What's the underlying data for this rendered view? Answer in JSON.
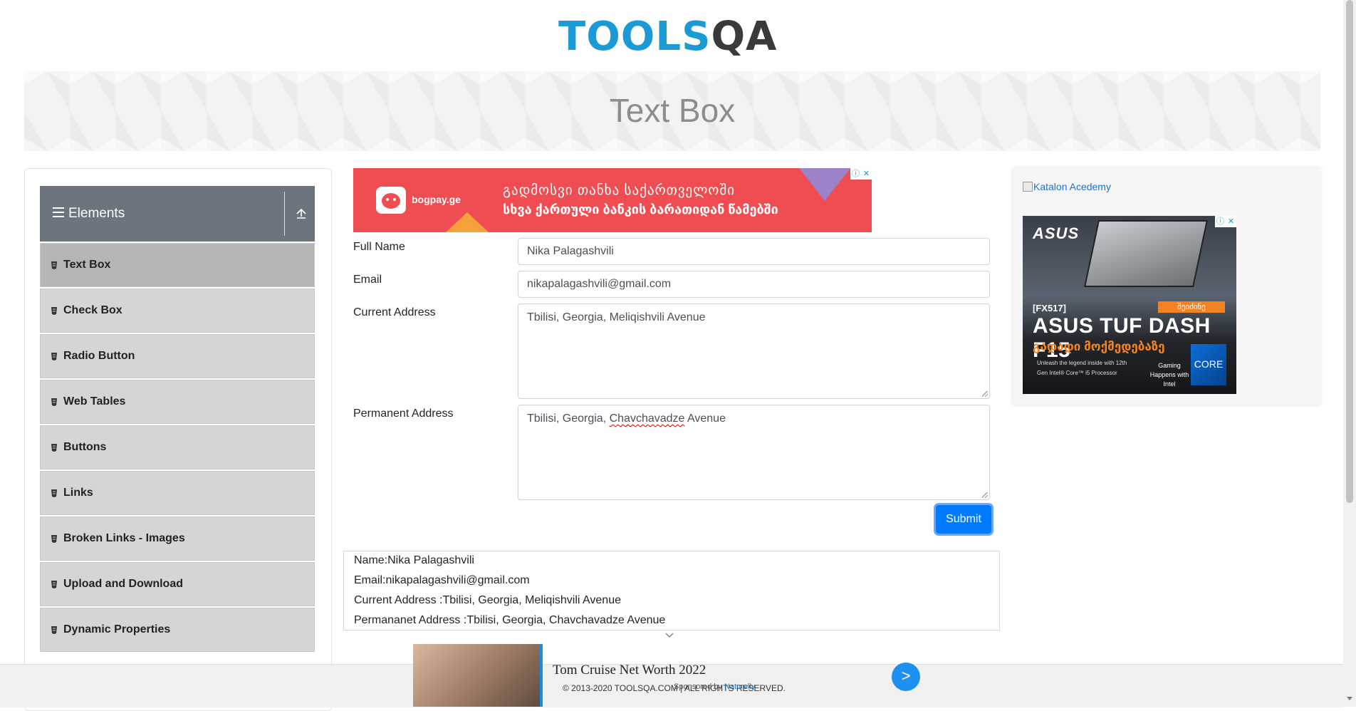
{
  "header": {
    "logo_text_blue": "TOOLS",
    "logo_text_dark": "QA",
    "logo_alt": "TOOLSQA"
  },
  "banner": {
    "title": "Text Box"
  },
  "sidebar": {
    "group_title": "Elements",
    "items": [
      {
        "label": "Text Box",
        "active": true
      },
      {
        "label": "Check Box",
        "active": false
      },
      {
        "label": "Radio Button",
        "active": false
      },
      {
        "label": "Web Tables",
        "active": false
      },
      {
        "label": "Buttons",
        "active": false
      },
      {
        "label": "Links",
        "active": false
      },
      {
        "label": "Broken Links - Images",
        "active": false
      },
      {
        "label": "Upload and Download",
        "active": false
      },
      {
        "label": "Dynamic Properties",
        "active": false
      }
    ]
  },
  "top_ad": {
    "brand": "bogpay.ge",
    "line1": "გადმოსვი თანხა საქართველოში",
    "line2": "სხვა ქართული ბანკის ბარათიდან წამებში",
    "info_icon": "ⓘ",
    "close_icon": "✕"
  },
  "form": {
    "full_name_label": "Full Name",
    "full_name_value": "Nika Palagashvili",
    "email_label": "Email",
    "email_value": "nikapalagashvili@gmail.com",
    "current_address_label": "Current Address",
    "current_address_value": "Tbilisi, Georgia, Meliqishvili Avenue",
    "permanent_address_label": "Permanent Address",
    "permanent_address_pre": "Tbilisi, Georgia, ",
    "permanent_address_misspelled": "Chavchavadze",
    "permanent_address_post": " Avenue",
    "submit_label": "Submit"
  },
  "output": {
    "name": "Name:Nika Palagashvili",
    "email": "Email:nikapalagashvili@gmail.com",
    "current_address": "Current Address :Tbilisi, Georgia, Meliqishvili Avenue",
    "permanent_address": "Permananet Address :Tbilisi, Georgia, Chavchavadze Avenue"
  },
  "right_ad": {
    "broken_image_alt": "Katalon Acedemy",
    "asus_logo": "ASUS",
    "model": "[FX517]",
    "badge": "შეიძინე",
    "title": "ASUS TUF DASH F15",
    "geo_text": "გადადი მოქმედებაზე",
    "small_text": "Unleash the legend inside with 12th Gen Intel® Core™ i5 Processor",
    "gaming_text": "Gaming Happens with Intel",
    "intel_text": "CORE"
  },
  "bottom_ad": {
    "headline": "Tom Cruise Net Worth 2022",
    "sponsored_prefix": "Sponsored by ",
    "sponsored_brand": "Naturelly",
    "go_label": ">"
  },
  "footer": {
    "copyright": "© 2013-2020 TOOLSQA.COM | ALL RIGHTS RESERVED."
  },
  "colors": {
    "primary": "#007bff",
    "sidebar_header": "#6c757d",
    "menu_item": "#d5d5d5",
    "logo_blue": "#1b9ad6"
  }
}
